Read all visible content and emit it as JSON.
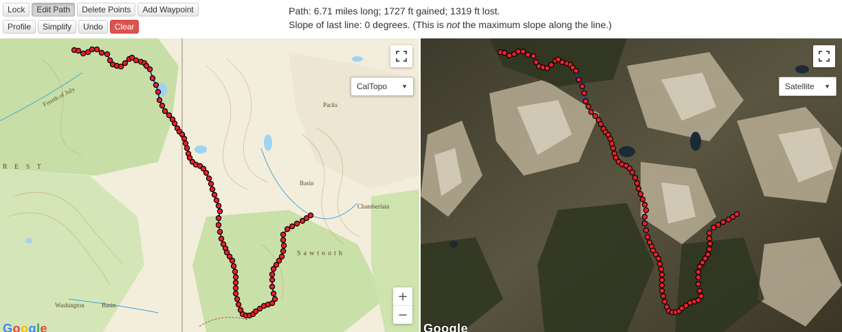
{
  "toolbar": {
    "lock": "Lock",
    "edit_path": "Edit Path",
    "delete_points": "Delete Points",
    "add_waypoint": "Add Waypoint",
    "profile": "Profile",
    "simplify": "Simplify",
    "undo": "Undo",
    "clear": "Clear"
  },
  "stats": {
    "line1": "Path: 6.71 miles long; 1727 ft gained; 1319 ft lost.",
    "line2_a": "Slope of last line: 0 degrees. (This is ",
    "line2_em": "not",
    "line2_b": " the maximum slope along the line.)"
  },
  "left_map": {
    "layer": "CalTopo",
    "labels": [
      "Packs",
      "R E S T",
      "Washington",
      "Basin",
      "Sawtooth",
      "Chamberlain",
      "Basin",
      "Fourth of July"
    ]
  },
  "right_map": {
    "layer": "Satellite"
  },
  "zoom": {
    "in": "+",
    "out": "−"
  },
  "google_logo": "Google",
  "colors": {
    "path": "#1a3cc8",
    "point_fill": "#e8202a",
    "point_stroke": "#000000",
    "clear_button": "#d9534f"
  }
}
